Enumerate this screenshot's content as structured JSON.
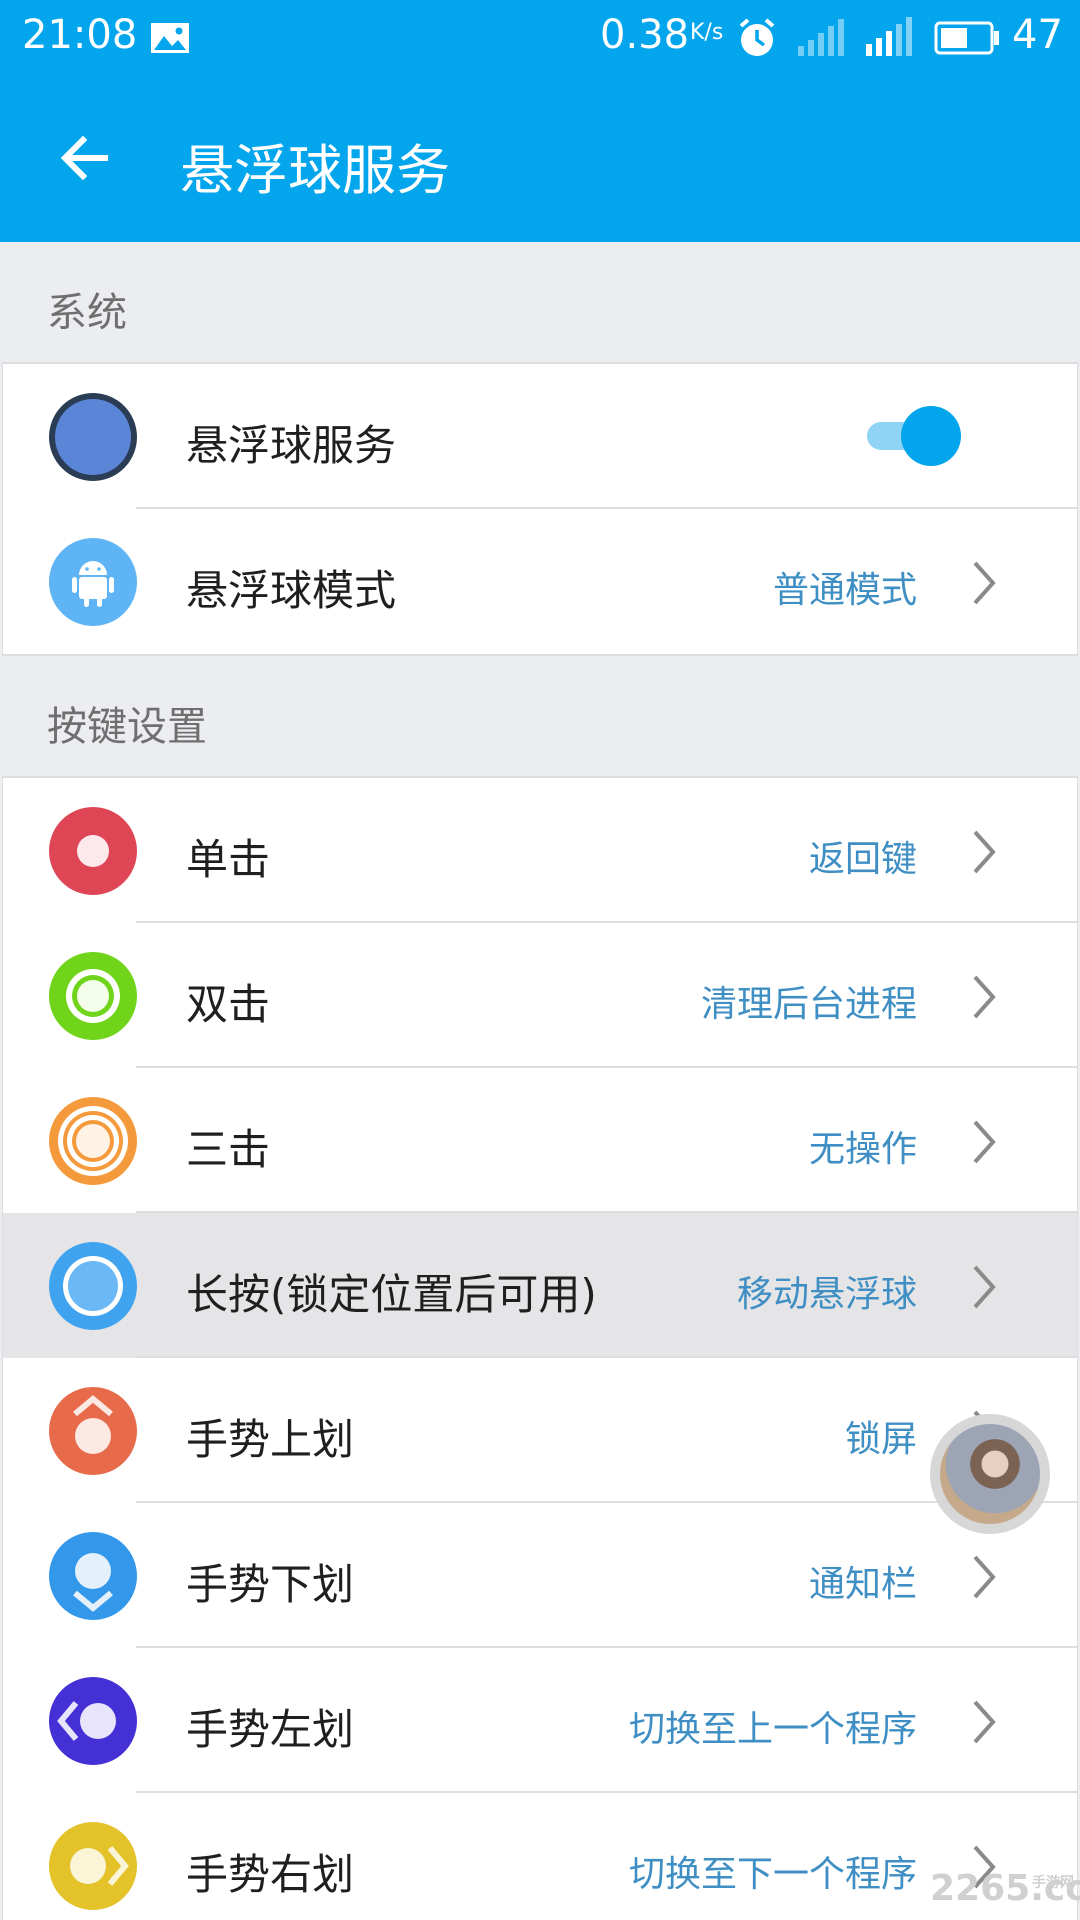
{
  "status_bar": {
    "time": "21:08",
    "net_speed": "0.38",
    "net_speed_unit": "K/s",
    "battery_level": "47",
    "icons": [
      "image-icon",
      "alarm-icon",
      "signal-icon",
      "hplus-signal-icon",
      "battery-icon"
    ]
  },
  "app_bar": {
    "title": "悬浮球服务",
    "back_icon": "back-arrow-icon",
    "background": "#03a5ec"
  },
  "sections": [
    {
      "header": "系统",
      "items": [
        {
          "label": "悬浮球服务",
          "icon": "floating-ball-icon",
          "toggle_on": true
        },
        {
          "label": "悬浮球模式",
          "value": "普通模式",
          "icon": "android-icon"
        }
      ]
    },
    {
      "header": "按键设置",
      "items": [
        {
          "label": "单击",
          "value": "返回键",
          "icon": "single-tap-icon"
        },
        {
          "label": "双击",
          "value": "清理后台进程",
          "icon": "double-tap-icon"
        },
        {
          "label": "三击",
          "value": "无操作",
          "icon": "triple-tap-icon"
        },
        {
          "label": "长按(锁定位置后可用)",
          "value": "移动悬浮球",
          "icon": "long-press-icon"
        },
        {
          "label": "手势上划",
          "value": "锁屏",
          "icon": "swipe-up-icon"
        },
        {
          "label": "手势下划",
          "value": "通知栏",
          "icon": "swipe-down-icon"
        },
        {
          "label": "手势左划",
          "value": "切换至上一个程序",
          "icon": "swipe-left-icon"
        },
        {
          "label": "手势右划",
          "value": "切换至下一个程序",
          "icon": "swipe-right-icon"
        }
      ]
    }
  ],
  "colors": {
    "accent": "#03a5ec",
    "value_text": "#3f8fc4",
    "single_tap": "#de4656",
    "double_tap": "#6fd41a",
    "triple_tap": "#f59a3c",
    "long_press": "#3fa3f0",
    "swipe_up": "#e76a4b",
    "swipe_down": "#3498ea",
    "swipe_left": "#4530d6",
    "swipe_right": "#e4c22a"
  },
  "watermark": {
    "brand": "2265",
    "suffix": ".com",
    "tag": "手游网"
  }
}
